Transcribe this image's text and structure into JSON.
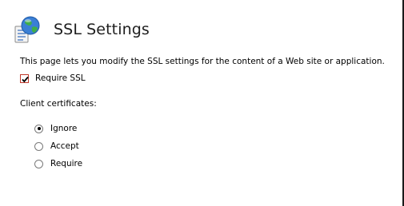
{
  "page": {
    "title": "SSL Settings",
    "icon": "globe-document-icon",
    "description": "This page lets you modify the SSL settings for the content of a Web site or application."
  },
  "require_ssl": {
    "label": "Require SSL",
    "checked": true
  },
  "client_certificates": {
    "label": "Client certificates:",
    "options": [
      {
        "label": "Ignore",
        "selected": true
      },
      {
        "label": "Accept",
        "selected": false
      },
      {
        "label": "Require",
        "selected": false
      }
    ]
  },
  "colors": {
    "checkbox_border": "#c0392b",
    "globe_blue": "#3a7fd5",
    "globe_green": "#3fae49"
  }
}
